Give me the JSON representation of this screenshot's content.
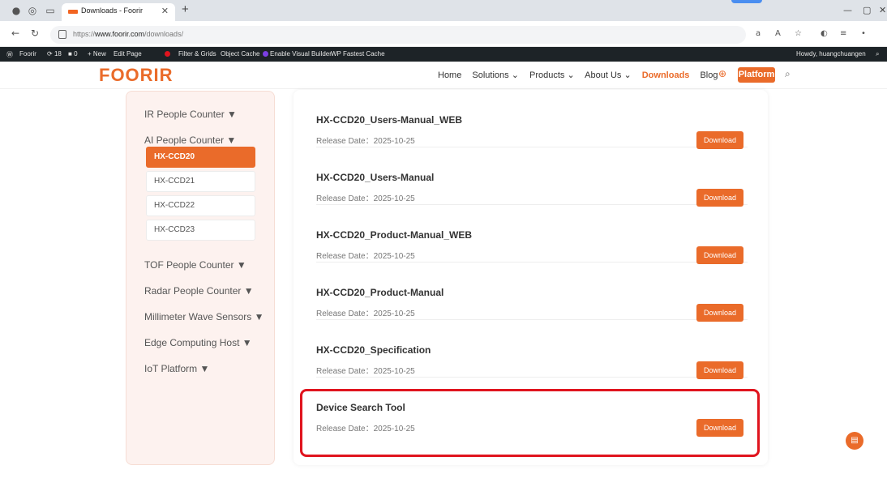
{
  "browser": {
    "tab_title": "Downloads - Foorir",
    "url_prefix": "https://",
    "url_domain": "www.foorir.com",
    "url_path": "/downloads/",
    "icons": [
      "profile-icon",
      "workspaces-icon",
      "tab-actions-icon",
      "back-icon",
      "refresh-icon",
      "lock-icon",
      "read-aloud-icon",
      "text-size-icon",
      "favorite-icon",
      "copilot-icon",
      "favorites-bar-icon",
      "extensions-icon"
    ]
  },
  "wp_bar": {
    "site": "Foorir",
    "updates": "18",
    "comments": "0",
    "new": "+ New",
    "edit_page": "Edit Page",
    "filter": "Filter & Grids",
    "object_cache": "Object Cache",
    "visual_builder": "Enable Visual Builder",
    "fastest_cache": "WP Fastest Cache",
    "howdy": "Howdy, huangchuangen"
  },
  "header": {
    "logo": "FOORIR",
    "menu": {
      "home": "Home",
      "solutions": "Solutions ⌄",
      "products": "Products ⌄",
      "about": "About Us ⌄",
      "downloads": "Downloads",
      "blog": "Blog"
    },
    "platform": "Platform"
  },
  "sidebar": {
    "categories": {
      "ir": "IR People Counter ▼",
      "ai": "AI People Counter ▼",
      "tof": "TOF People Counter ▼",
      "radar": "Radar People Counter ▼",
      "mmwave": "Millimeter Wave Sensors ▼",
      "edge": "Edge Computing Host ▼",
      "iot": "IoT Platform ▼"
    },
    "subitems": [
      "HX-CCD20",
      "HX-CCD21",
      "HX-CCD22",
      "HX-CCD23"
    ]
  },
  "downloads": {
    "items": [
      {
        "name": "HX-CCD20_Users-Manual_WEB",
        "date": "Release Date：2025-10-25"
      },
      {
        "name": "HX-CCD20_Users-Manual",
        "date": "Release Date：2025-10-25"
      },
      {
        "name": "HX-CCD20_Product-Manual_WEB",
        "date": "Release Date：2025-10-25"
      },
      {
        "name": "HX-CCD20_Product-Manual",
        "date": "Release Date：2025-10-25"
      },
      {
        "name": "HX-CCD20_Specification",
        "date": "Release Date：2025-10-25"
      },
      {
        "name": "Device Search Tool",
        "date": "Release Date：2025-10-25"
      }
    ],
    "button_label": "Download"
  },
  "colors": {
    "accent": "#ea6b2a",
    "highlight": "#e0141e",
    "sidebar_bg": "#fdf2ef",
    "wpbar": "#1d2327"
  }
}
